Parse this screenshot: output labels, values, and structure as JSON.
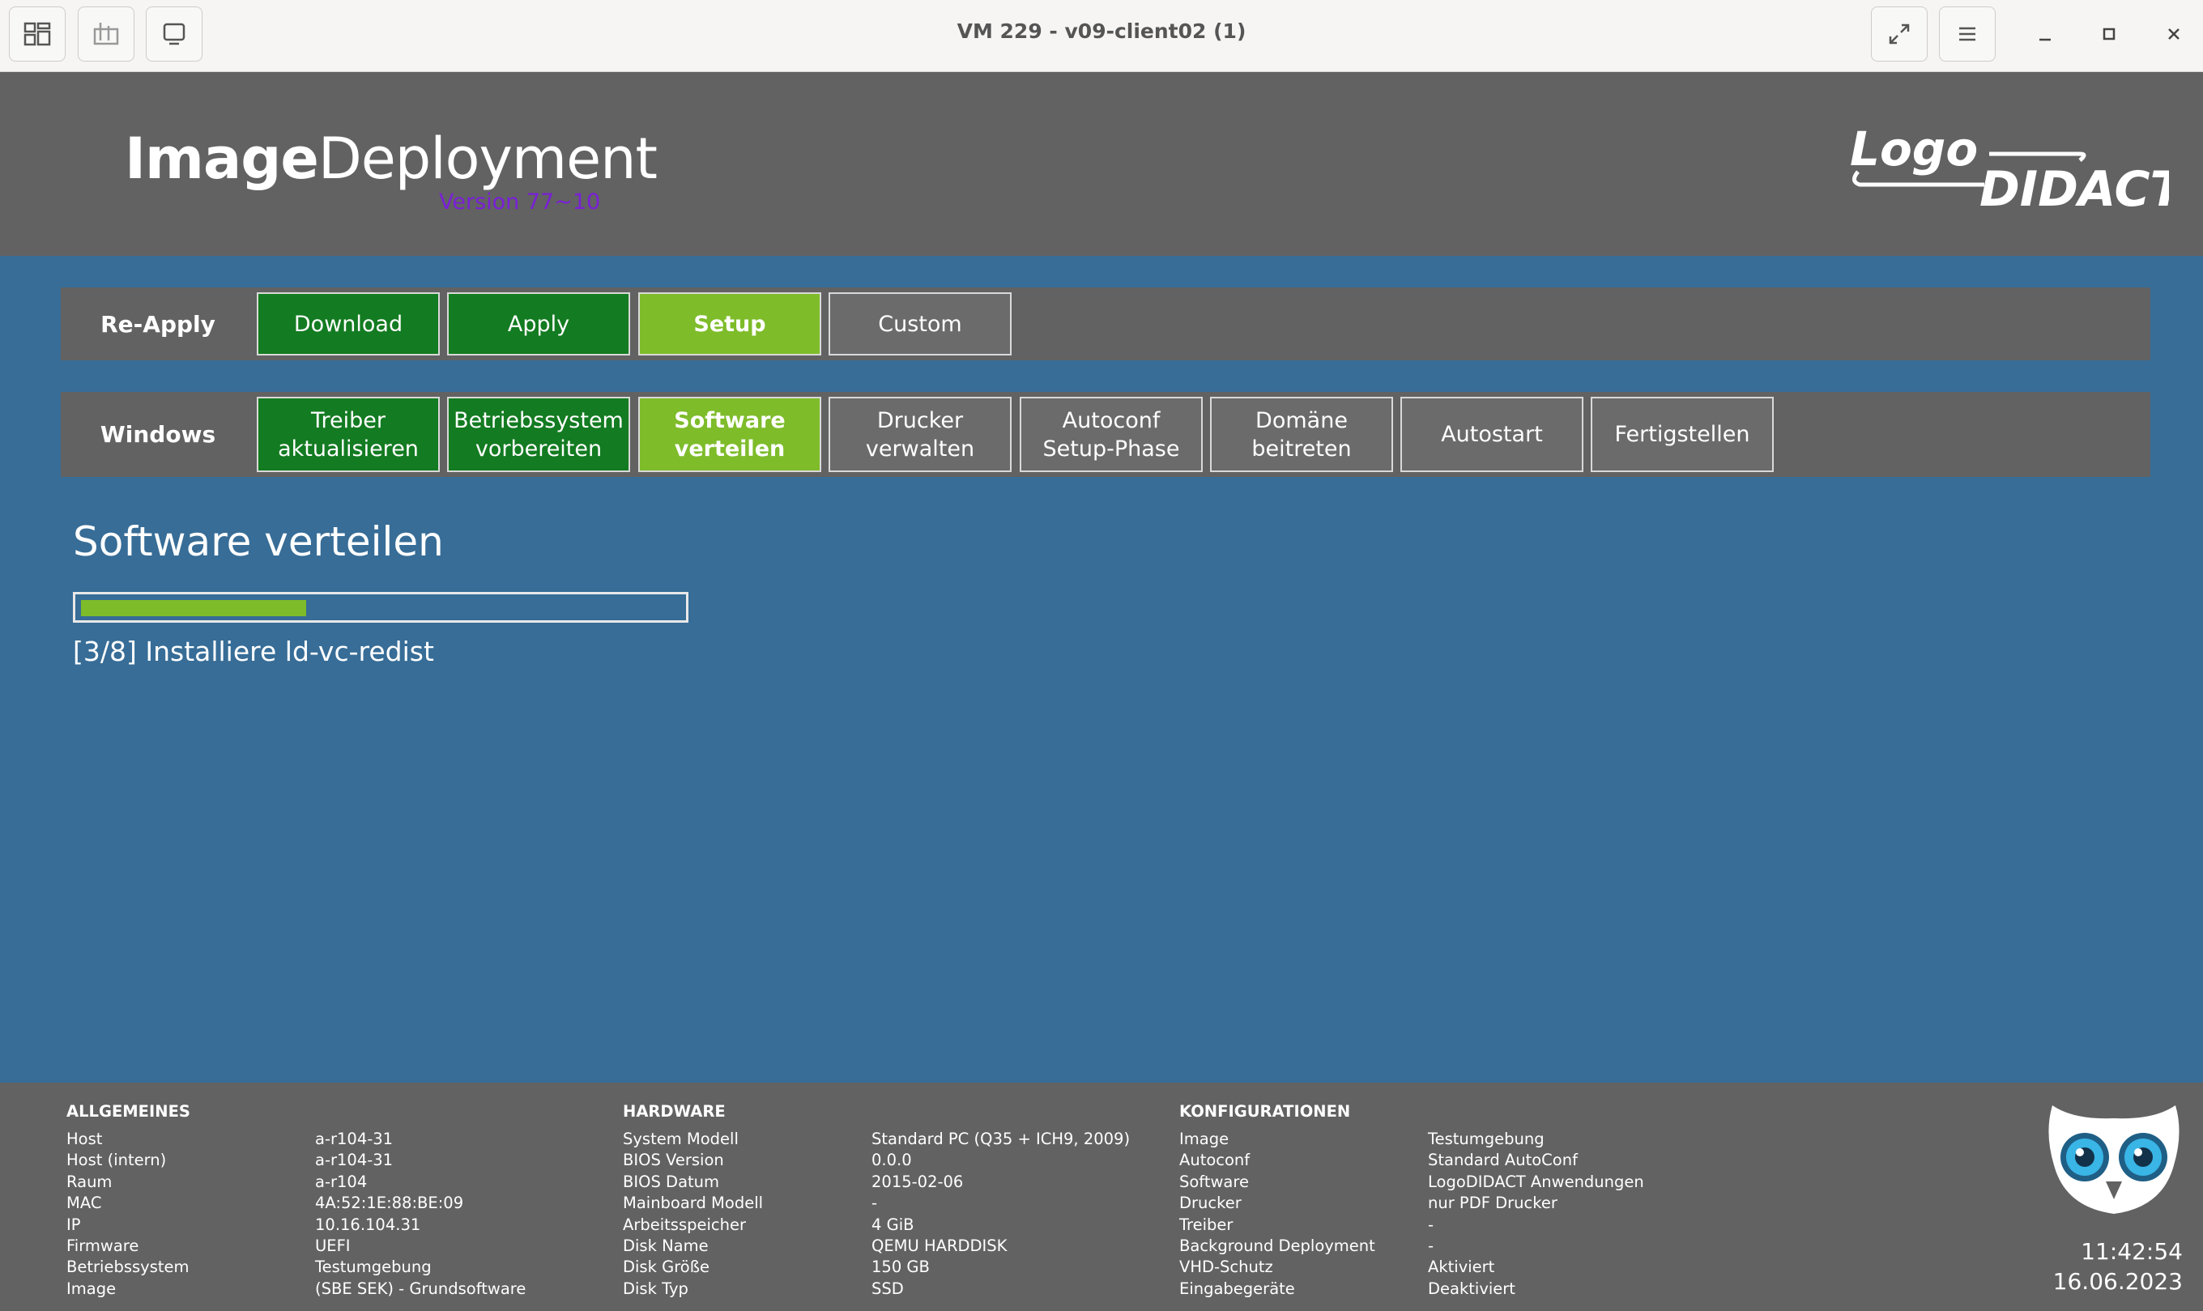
{
  "window": {
    "title": "VM 229 - v09-client02 (1)",
    "icons": [
      "overview-icon",
      "send-keys-icon",
      "display-icon",
      "fullscreen-icon",
      "menu-icon",
      "minimize-icon",
      "maximize-icon",
      "close-icon"
    ]
  },
  "header": {
    "brand_bold": "Image",
    "brand_light": "Deployment",
    "version": "Version 77~10",
    "logo_text_top": "Logo",
    "logo_text_bottom": "DIDACT"
  },
  "reapply": {
    "label": "Re-Apply",
    "buttons": [
      {
        "label": "Download",
        "state": "done"
      },
      {
        "label": "Apply",
        "state": "done"
      },
      {
        "label": "Setup",
        "state": "active"
      },
      {
        "label": "Custom",
        "state": "pending"
      }
    ]
  },
  "windows": {
    "label": "Windows",
    "buttons": [
      {
        "line1": "Treiber",
        "line2": "aktualisieren",
        "state": "done"
      },
      {
        "line1": "Betriebssystem",
        "line2": "vorbereiten",
        "state": "done"
      },
      {
        "line1": "Software",
        "line2": "verteilen",
        "state": "active"
      },
      {
        "line1": "Drucker",
        "line2": "verwalten",
        "state": "pending"
      },
      {
        "line1": "Autoconf",
        "line2": "Setup-Phase",
        "state": "pending"
      },
      {
        "line1": "Domäne",
        "line2": "beitreten",
        "state": "pending"
      },
      {
        "line1": "Autostart",
        "line2": "",
        "state": "pending"
      },
      {
        "line1": "Fertigstellen",
        "line2": "",
        "state": "pending"
      }
    ]
  },
  "main": {
    "title": "Software verteilen",
    "progress_fraction": 0.375,
    "status": "[3/8] Installiere ld-vc-redist"
  },
  "footer": {
    "general": {
      "title": "ALLGEMEINES",
      "rows": [
        {
          "key": "Host",
          "value": "a-r104-31"
        },
        {
          "key": "Host (intern)",
          "value": "a-r104-31"
        },
        {
          "key": "Raum",
          "value": "a-r104"
        },
        {
          "key": "MAC",
          "value": "4A:52:1E:88:BE:09"
        },
        {
          "key": "IP",
          "value": "10.16.104.31"
        },
        {
          "key": "Firmware",
          "value": "UEFI"
        },
        {
          "key": "Betriebssystem",
          "value": "Testumgebung"
        },
        {
          "key": "Image",
          "value": "(SBE SEK) - Grundsoftware"
        }
      ]
    },
    "hardware": {
      "title": "HARDWARE",
      "rows": [
        {
          "key": "System Modell",
          "value": "Standard PC (Q35 + ICH9, 2009)"
        },
        {
          "key": "BIOS Version",
          "value": "0.0.0"
        },
        {
          "key": "BIOS Datum",
          "value": "2015-02-06"
        },
        {
          "key": "Mainboard Modell",
          "value": "-"
        },
        {
          "key": "Arbeitsspeicher",
          "value": "4 GiB"
        },
        {
          "key": "Disk Name",
          "value": "QEMU HARDDISK"
        },
        {
          "key": "Disk Größe",
          "value": "150 GB"
        },
        {
          "key": "Disk Typ",
          "value": "SSD"
        }
      ]
    },
    "config": {
      "title": "KONFIGURATIONEN",
      "rows": [
        {
          "key": "Image",
          "value": "Testumgebung"
        },
        {
          "key": "Autoconf",
          "value": "Standard AutoConf"
        },
        {
          "key": "Software",
          "value": "LogoDIDACT Anwendungen"
        },
        {
          "key": "Drucker",
          "value": "nur PDF Drucker"
        },
        {
          "key": "Treiber",
          "value": "-"
        },
        {
          "key": "Background Deployment",
          "value": "-"
        },
        {
          "key": "VHD-Schutz",
          "value": "Aktiviert"
        },
        {
          "key": "Eingabegeräte",
          "value": "Deaktiviert"
        }
      ]
    },
    "time": "11:42:54",
    "date": "16.06.2023"
  },
  "colors": {
    "background": "#376d97",
    "panel": "#626262",
    "done": "#137b21",
    "active": "#7ebc2a",
    "pending": "#6b6b6b",
    "version": "#7a1fd8"
  }
}
